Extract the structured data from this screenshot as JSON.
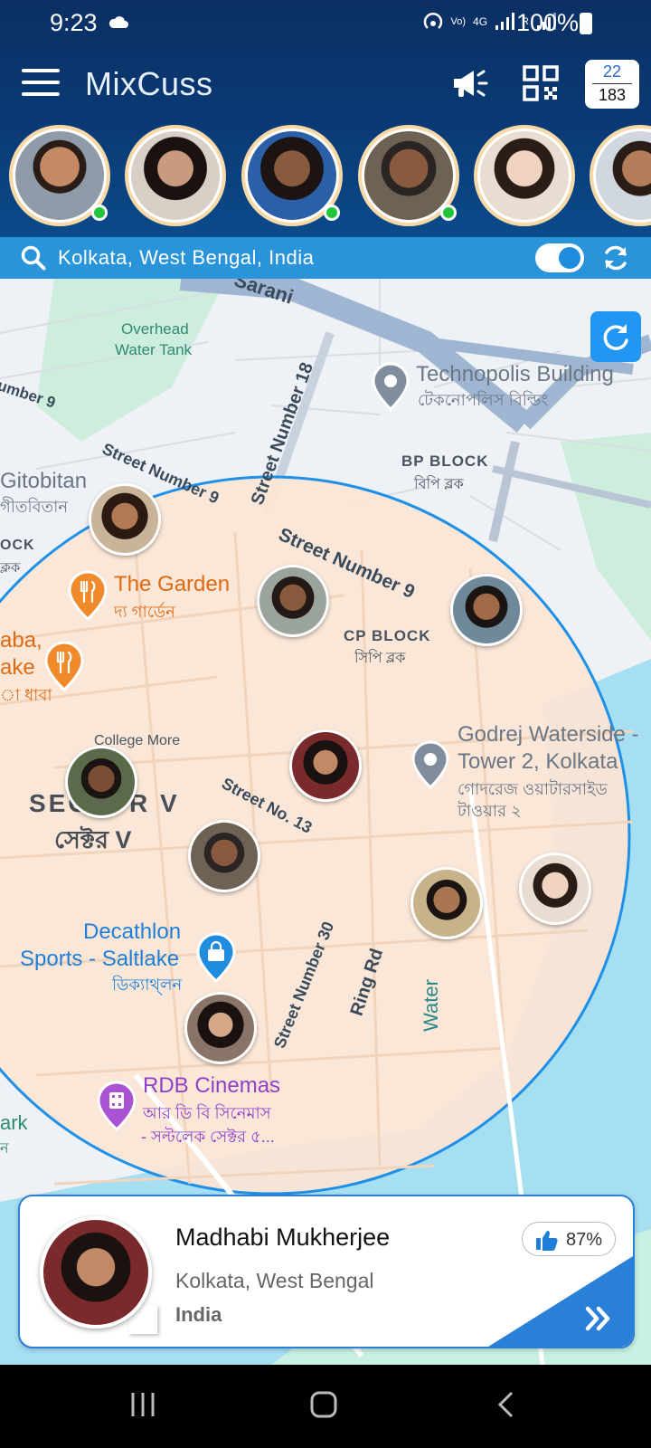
{
  "status_bar": {
    "time": "9:23",
    "battery": "100%",
    "network_labels": [
      "Vo)",
      "LTE1",
      "4G",
      "R"
    ]
  },
  "app": {
    "title": "MixCuss",
    "counter_top": "22",
    "counter_bottom": "183"
  },
  "search": {
    "location_value": "Kolkata, West Bengal, India",
    "toggle_on": true
  },
  "map": {
    "road_labels": [
      "Sarani",
      "Street Number 18",
      "Street Number 9",
      "Street Number 9",
      "Street No. 13",
      "Street Number 30",
      "Ring Rd",
      "umber 9"
    ],
    "area_labels": {
      "overhead_1": "Overhead",
      "overhead_2": "Water Tank",
      "bp_block": "BP BLOCK",
      "bp_block_bn": "বিপি ব্লক",
      "cp_block": "CP BLOCK",
      "cp_block_bn": "সিপি ব্লক",
      "college_more": "College More",
      "sector_v": "SECTOR V",
      "sector_v_bn": "সেক্টর V",
      "water": "Water",
      "ock": "OCK",
      "ock_bn": "ক্লক",
      "park": "ark",
      "park_bn": "ন"
    },
    "places": {
      "technopolis": "Technopolis Building",
      "technopolis_bn": "টেকনোপলিস বিল্ডিং",
      "gitobitan": "Gitobitan",
      "gitobitan_bn": "গীতবিতান",
      "garden": "The Garden",
      "garden_bn": "দ্য গার্ডেন",
      "dhaba_1": "aba,",
      "dhaba_2": "ake",
      "dhaba_bn": "া ধাবা",
      "godrej_1": "Godrej Waterside -",
      "godrej_2": "Tower 2, Kolkata",
      "godrej_bn_1": "গোদরেজ ওয়াটারসাইড",
      "godrej_bn_2": "টাওয়ার ২",
      "decathlon_1": "Decathlon",
      "decathlon_2": "Sports - Saltlake",
      "decathlon_bn": "ডিক্যাথ্‌লন",
      "rdb": "RDB Cinemas",
      "rdb_bn_1": "আর ডি বি সিনেমাস",
      "rdb_bn_2": "- সল্টলেক সেক্টর ৫..."
    }
  },
  "profile_card": {
    "name": "Madhabi Mukherjee",
    "city": "Kolkata, West Bengal",
    "country": "India",
    "like_percent": "87%"
  },
  "colors": {
    "header": "#0b3c78",
    "search_bar": "#2a94db",
    "radius_fill": "#fbe6d4",
    "radius_stroke": "#1e90e8",
    "water": "#a6dff2",
    "online": "#22c43a",
    "accent_blue": "#2a7fd8"
  }
}
